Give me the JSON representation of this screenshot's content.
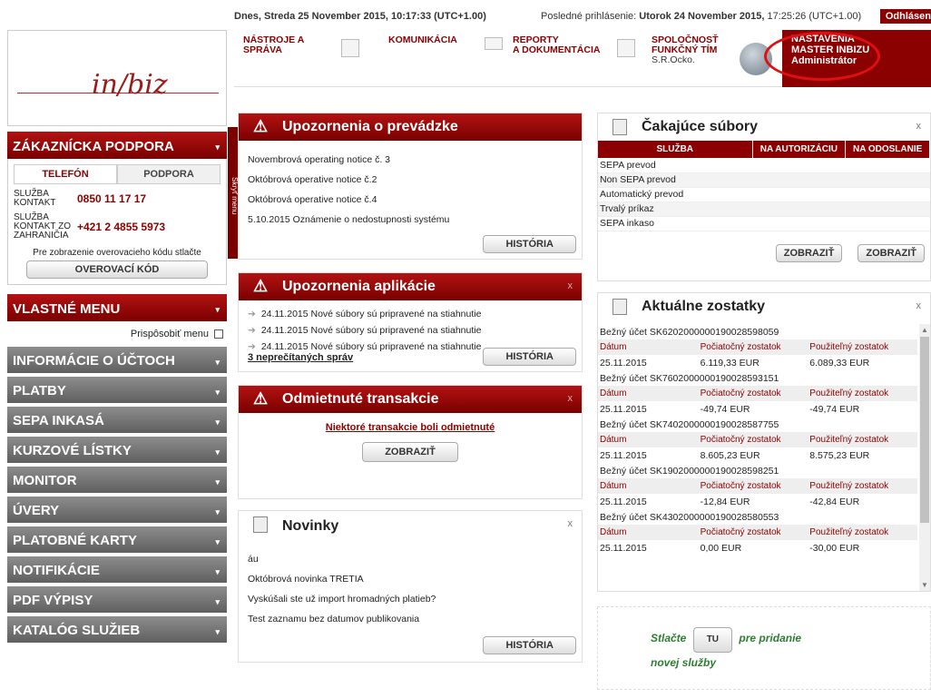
{
  "topbar": {
    "date": "Dnes, Streda 25 November 2015, 10:17:33 (UTC+1.00)",
    "last_login_prefix": "Posledné prihlásenie:",
    "last_login_value": "Utorok 24 November 2015,",
    "last_login_time": "17:25:26 (UTC+1.00)",
    "logout": "Odhlásen"
  },
  "logo": {
    "text": "in/biz"
  },
  "topnav": {
    "items": [
      {
        "label1": "NÁSTROJE A",
        "label2": "SPRÁVA"
      },
      {
        "label1": "KOMUNIKÁCIA",
        "label2": ""
      },
      {
        "label1": "REPORTY",
        "label2": "A DOKUMENTÁCIA"
      },
      {
        "label1": "SPOLOČNOSŤ",
        "label2": "FUNKČNÝ TÍM",
        "label3": "S.R.Ocko."
      }
    ],
    "settings": {
      "line1": "NASTAVENIA",
      "line2": "MASTER INBIZU",
      "line3": "Administrátor"
    }
  },
  "support": {
    "title": "ZÁKAZNÍCKA PODPORA",
    "tab_phone": "TELEFÓN",
    "tab_support": "PODPORA",
    "contacts": [
      {
        "label": "SLUŽBA KONTAKT",
        "number": "0850 11 17 17"
      },
      {
        "label": "SLUŽBA KONTAKT ZO ZAHRANIČIA",
        "number": "+421 2 4855 5973"
      }
    ],
    "verify_text": "Pre zobrazenie overovacieho kódu stlačte",
    "verify_button": "OVEROVACÍ KÓD"
  },
  "custom_menu": {
    "title": "VLASTNÉ MENU",
    "customize": "Prispôsobiť menu"
  },
  "menu": [
    "INFORMÁCIE O ÚČTOCH",
    "PLATBY",
    "SEPA INKASÁ",
    "KURZOVÉ LÍSTKY",
    "MONITOR",
    "ÚVERY",
    "PLATOBNÉ KARTY",
    "NOTIFIKÁCIE",
    "PDF VÝPISY",
    "KATALÓG SLUŽIEB"
  ],
  "collapse_label": "Skryť menu",
  "operations": {
    "title": "Upozornenia o prevádzke",
    "items": [
      "Novembrová operating notice č. 3",
      "Októbrová operative notice č.2",
      "Októbrová operative notice č.4",
      "5.10.2015 Oznámenie o nedostupnosti systému"
    ],
    "button": "HISTÓRIA"
  },
  "app_notices": {
    "title": "Upozornenia aplikácie",
    "close": "x",
    "items": [
      "24.11.2015 Nové súbory sú pripravené na stiahnutie",
      "24.11.2015 Nové súbory sú pripravené na stiahnutie",
      "24.11.2015 Nové súbory sú pripravené na stiahnutie"
    ],
    "unread": "3 neprečítaných správ",
    "button": "HISTÓRIA"
  },
  "rejected": {
    "title": "Odmietnuté transakcie",
    "close": "x",
    "text": "Niektoré transakcie boli odmietnuté",
    "button": "ZOBRAZIŤ"
  },
  "news": {
    "title": "Novinky",
    "close": "x",
    "items": [
      "áu",
      "Októbrová novinka TRETIA",
      "Vyskúšali ste už import hromadných platieb?",
      "Test zaznamu bez datumov publikovania"
    ],
    "button": "HISTÓRIA"
  },
  "pending": {
    "title": "Čakajúce súbory",
    "close": "x",
    "columns": [
      "SLUŽBA",
      "NA AUTORIZÁCIU",
      "NA ODOSLANIE"
    ],
    "rows": [
      "SEPA prevod",
      "Non SEPA prevod",
      "Automatický prevod",
      "Trvalý príkaz",
      "SEPA inkaso"
    ],
    "button1": "ZOBRAZIŤ",
    "button2": "ZOBRAZIŤ"
  },
  "balances": {
    "title": "Aktuálne zostatky",
    "close": "x",
    "col_date": "Dátum",
    "col_start": "Počiatočný zostatok",
    "col_avail": "Použiteľný zostatok",
    "accounts": [
      {
        "name": "Bežný účet SK6202000000190028598059",
        "date": "25.11.2015",
        "start": "6.119,33 EUR",
        "avail": "6.089,33 EUR"
      },
      {
        "name": "Bežný účet SK7602000000190028593151",
        "date": "25.11.2015",
        "start": "-49,74 EUR",
        "avail": "-49,74 EUR"
      },
      {
        "name": "Bežný účet SK7402000000190028587755",
        "date": "25.11.2015",
        "start": "8.605,23 EUR",
        "avail": "8.575,23 EUR"
      },
      {
        "name": "Bežný účet SK1902000000190028598251",
        "date": "25.11.2015",
        "start": "-12,84 EUR",
        "avail": "-42,84 EUR"
      },
      {
        "name": "Bežný účet SK4302000000190028580553",
        "date": "25.11.2015",
        "start": "0,00 EUR",
        "avail": "-30,00 EUR"
      }
    ]
  },
  "add_service": {
    "pre": "Stlačte",
    "button": "TU",
    "post": "pre pridanie",
    "line2": "novej služby"
  },
  "colors": {
    "brand": "#8b0000",
    "menu_grey": "#6f6f6f",
    "highlight": "#e01010",
    "service_text": "#2e7d32"
  }
}
